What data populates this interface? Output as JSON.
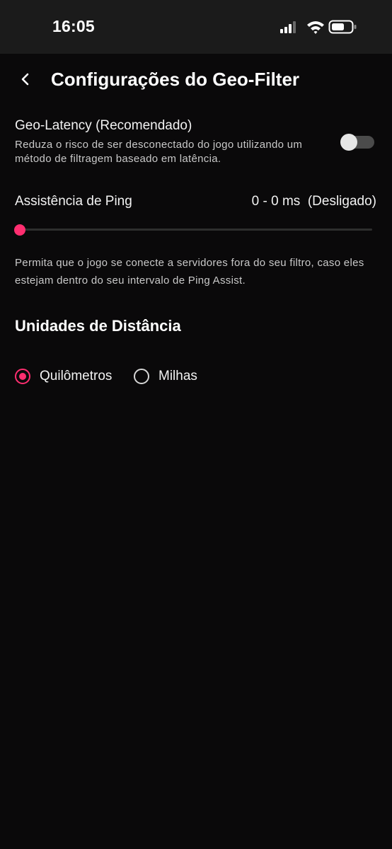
{
  "status_bar": {
    "time": "16:05",
    "icons": [
      "signal-icon",
      "wifi-icon",
      "battery-icon"
    ]
  },
  "header": {
    "back_icon": "chevron-left-icon",
    "title": "Configurações do Geo-Filter"
  },
  "geo_latency": {
    "title": "Geo-Latency (Recomendado)",
    "description": "Reduza o risco de ser desconectado do jogo utilizando um método de filtragem baseado em latência.",
    "enabled": false
  },
  "ping_assist": {
    "label": "Assistência de Ping",
    "value": "0 - 0 ms  (Desligado)",
    "slider_level": 0,
    "description": "Permita que o jogo se conecte a servidores fora do seu filtro, caso eles estejam dentro do seu intervalo de Ping Assist."
  },
  "distance_units": {
    "title": "Unidades de Distância",
    "options": [
      {
        "label": "Quilômetros",
        "selected": true
      },
      {
        "label": "Milhas",
        "selected": false
      }
    ]
  },
  "colors": {
    "accent": "#ff2e70",
    "background": "#0a090a",
    "status_bar": "#1b1b1b",
    "toggle_off_track": "#4b4b4b"
  }
}
